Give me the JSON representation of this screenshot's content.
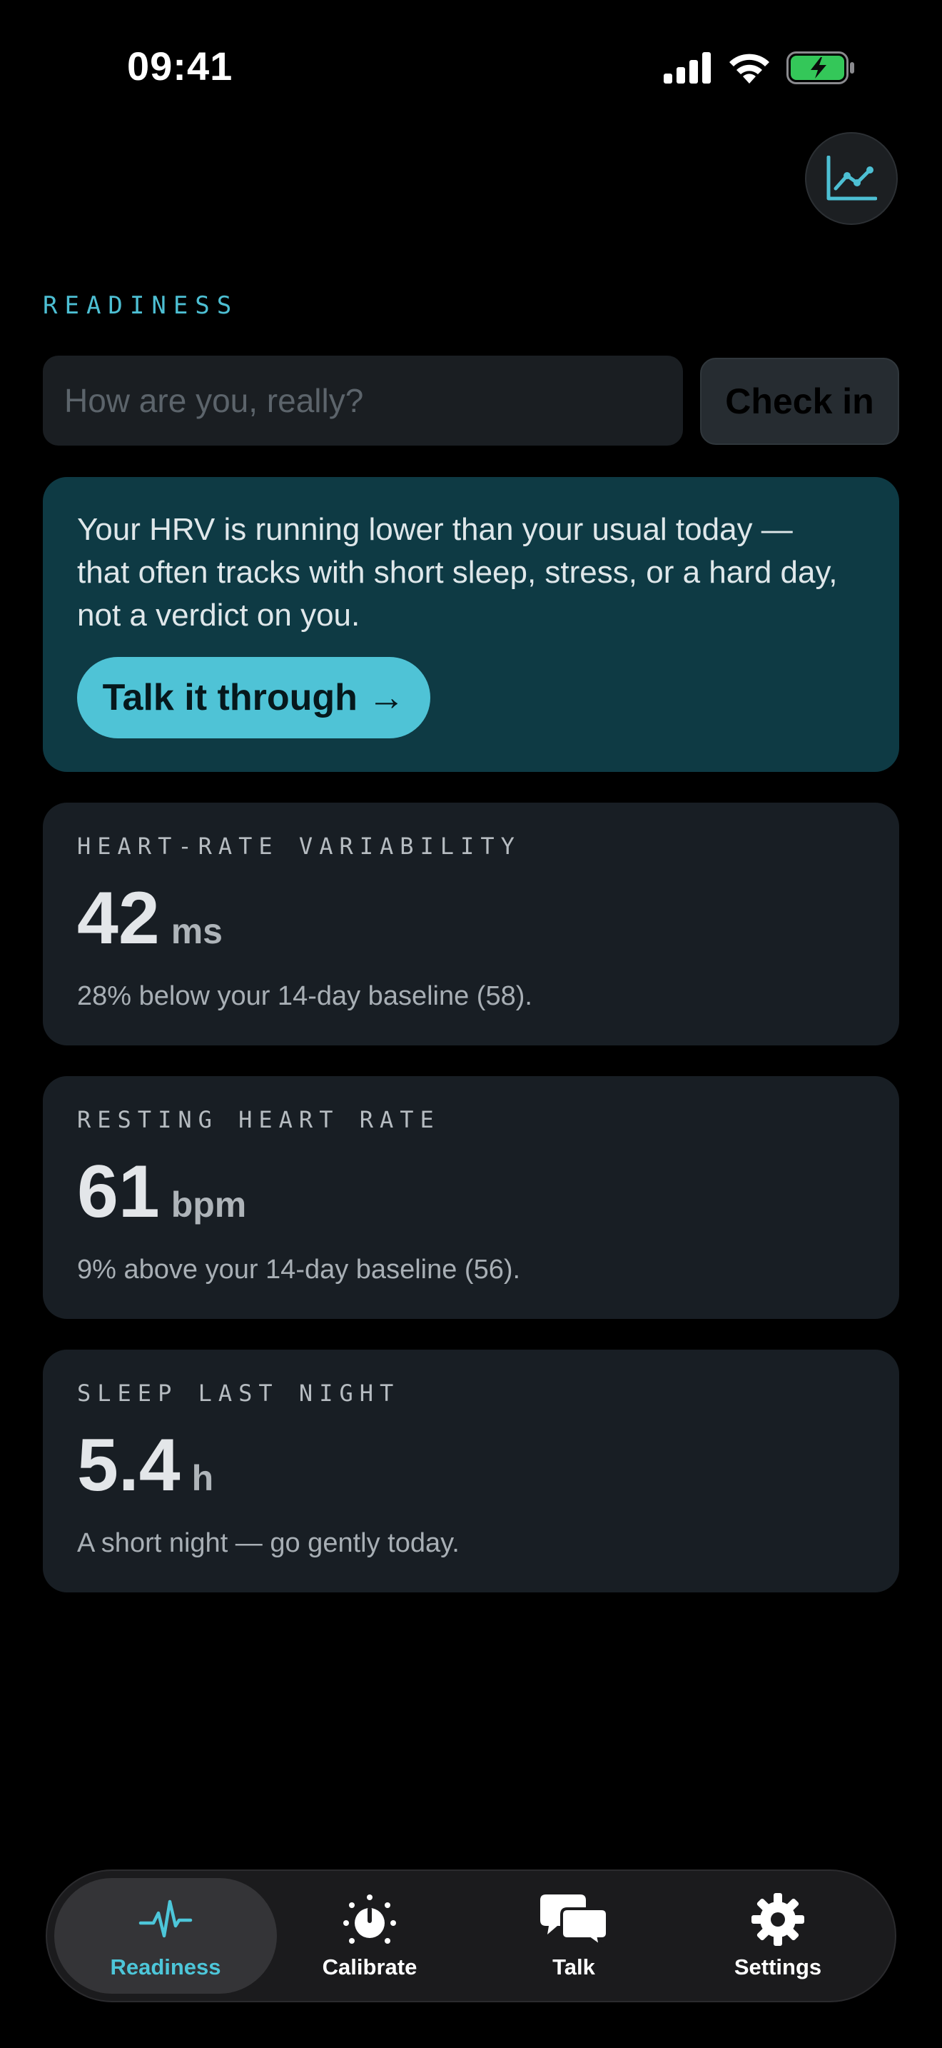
{
  "status_bar": {
    "time": "09:41",
    "icons": [
      "cellular-signal-icon",
      "wifi-icon",
      "battery-charging-icon"
    ],
    "battery_color": "#34c759"
  },
  "header": {
    "trend_icon": "line-chart-icon"
  },
  "section": {
    "label": "READINESS"
  },
  "checkin": {
    "placeholder": "How are you, really?",
    "value": "",
    "button_label": "Check in"
  },
  "insight": {
    "text": "Your HRV is running lower than your usual today — that often tracks with short sleep, stress, or a hard day, not a verdict on you.",
    "button_label": "Talk it through →"
  },
  "metrics": [
    {
      "label": "HEART-RATE VARIABILITY",
      "value": "42",
      "unit": "ms",
      "note": "28% below your 14-day baseline (58)."
    },
    {
      "label": "RESTING HEART RATE",
      "value": "61",
      "unit": "bpm",
      "note": "9% above your 14-day baseline (56)."
    },
    {
      "label": "SLEEP LAST NIGHT",
      "value": "5.4",
      "unit": "h",
      "note": "A short night — go gently today."
    }
  ],
  "tabs": [
    {
      "label": "Readiness",
      "icon": "pulse-icon",
      "active": true
    },
    {
      "label": "Calibrate",
      "icon": "dial-icon",
      "active": false
    },
    {
      "label": "Talk",
      "icon": "chat-bubbles-icon",
      "active": false
    },
    {
      "label": "Settings",
      "icon": "gear-icon",
      "active": false
    }
  ],
  "colors": {
    "accent": "#4dbfd3",
    "insight_card": "#0e3a44",
    "metric_card": "#181e24",
    "background": "#000000"
  }
}
